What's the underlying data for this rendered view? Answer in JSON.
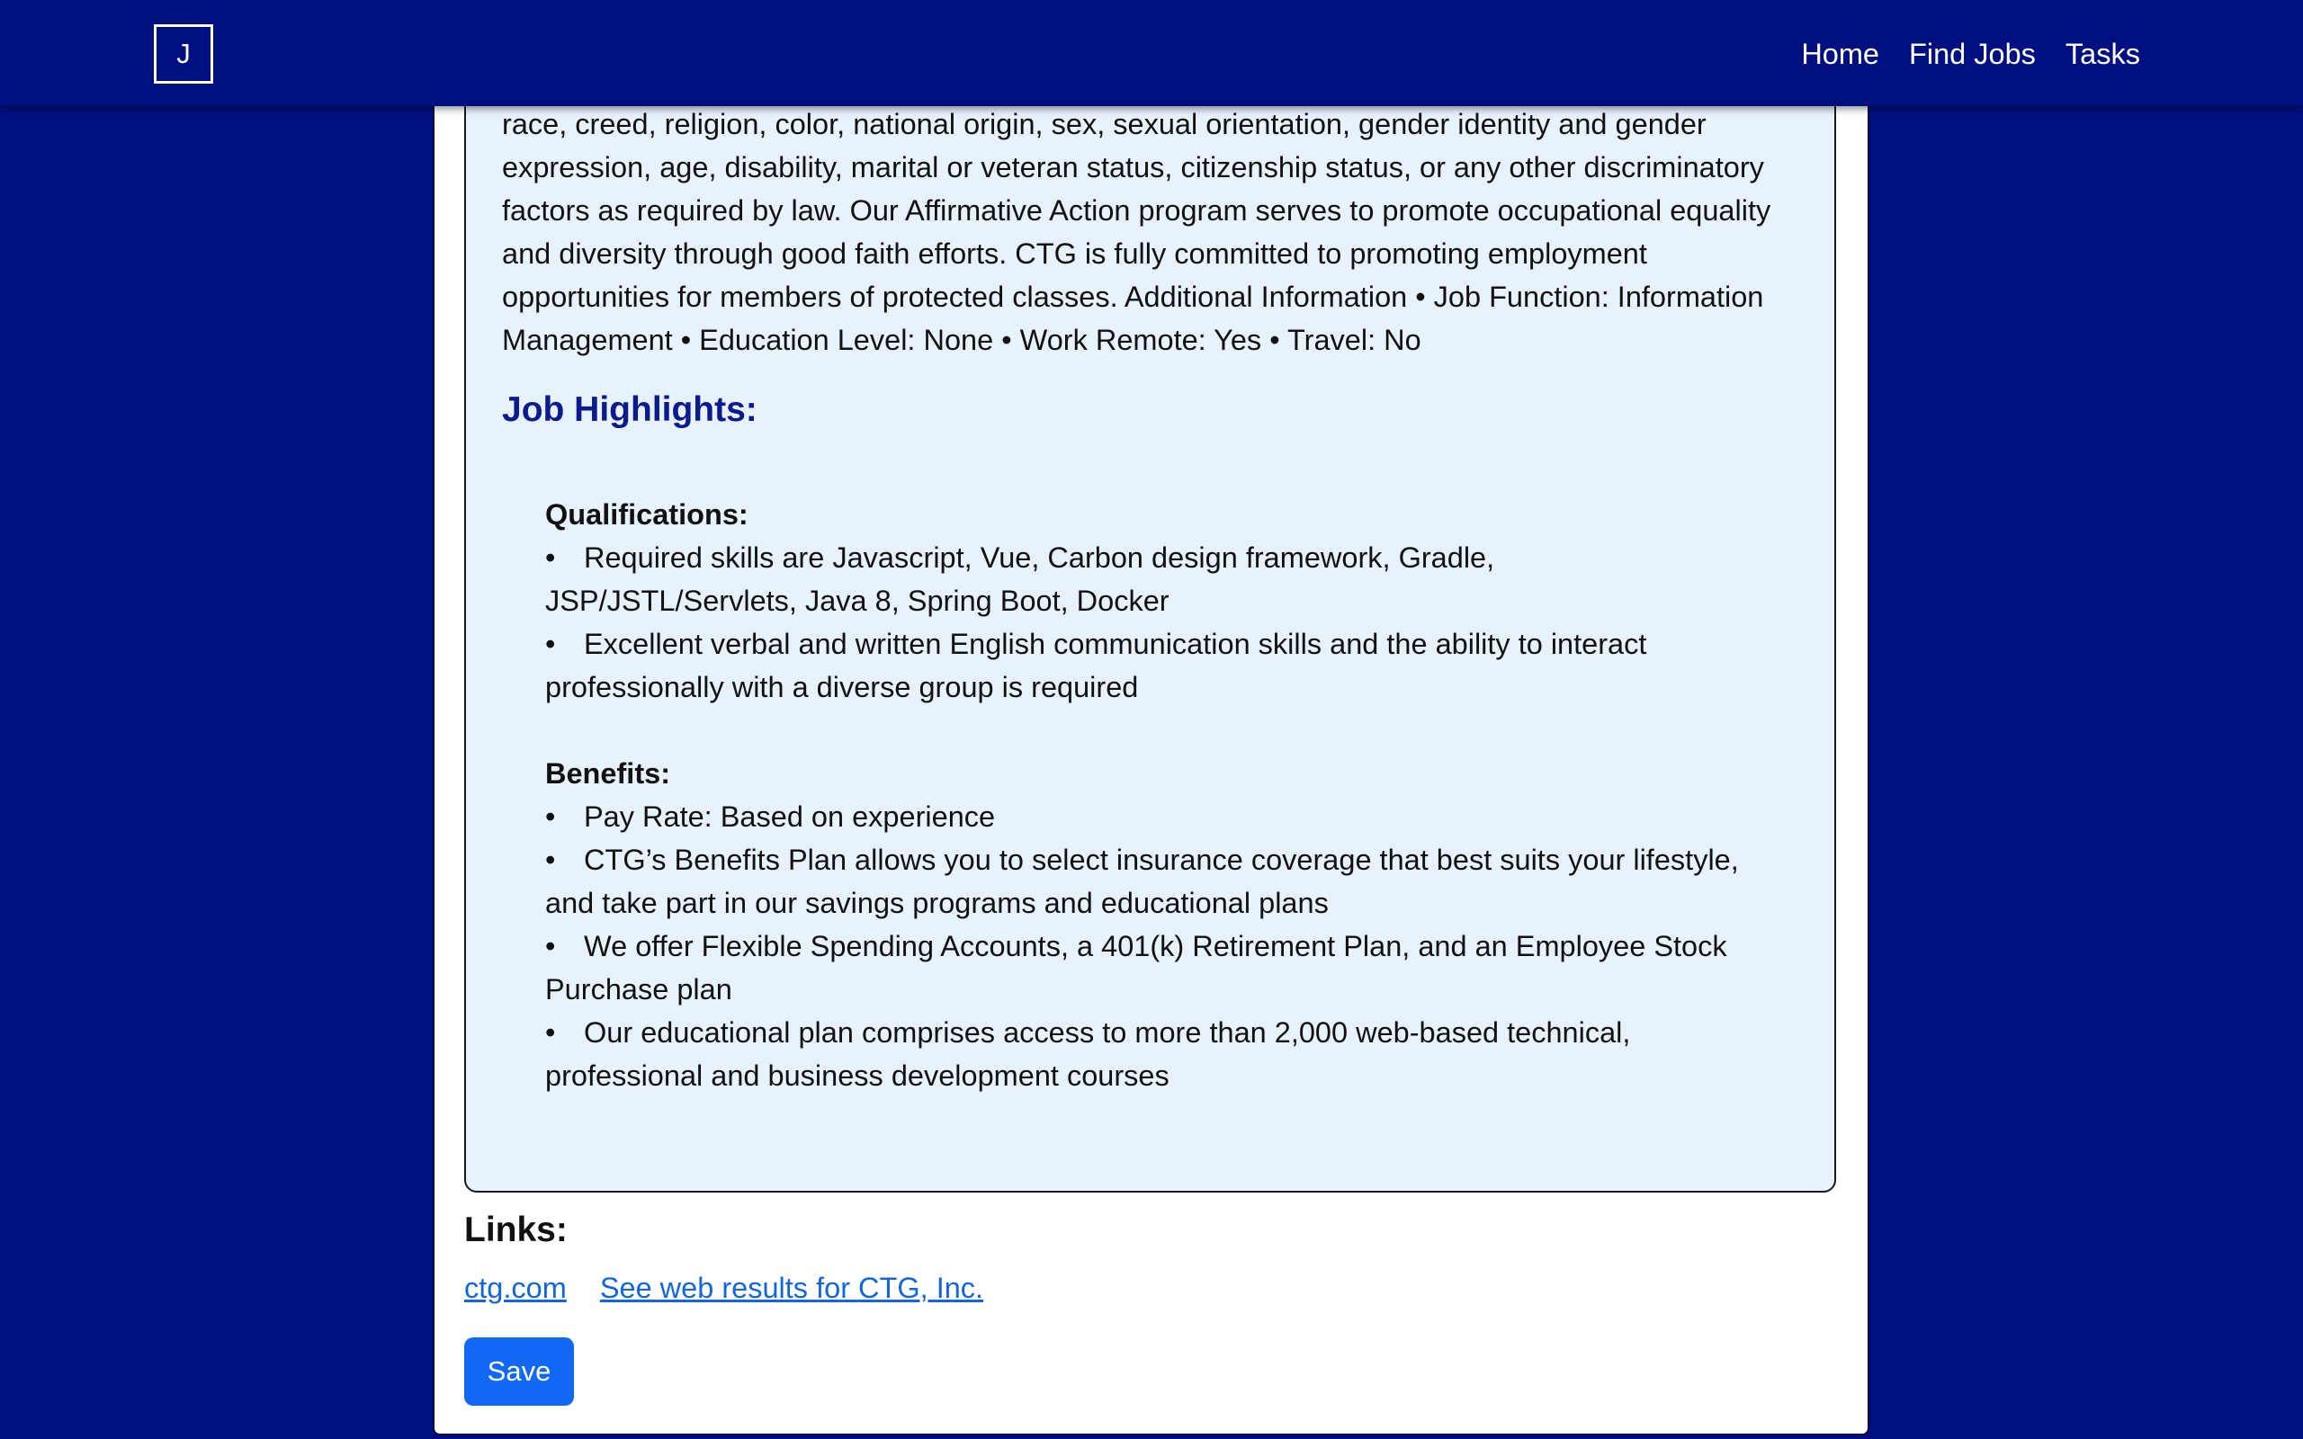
{
  "nav": {
    "logo_letter": "J",
    "links": [
      "Home",
      "Find Jobs",
      "Tasks"
    ]
  },
  "description": {
    "text": "training, benefits, compensation, promotion, transfer, and release of individuals without regard to race, creed, religion, color, national origin, sex, sexual orientation, gender identity and gender expression, age, disability, marital or veteran status, citizenship status, or any other discriminatory factors as required by law. Our Affirmative Action program serves to promote occupational equality and diversity through good faith efforts. CTG is fully committed to promoting employment opportunities for members of protected classes. Additional Information • Job Function: Information Management • Education Level: None • Work Remote: Yes • Travel: No"
  },
  "highlights": {
    "title": "Job Highlights:",
    "qualifications": {
      "title": "Qualifications:",
      "items": [
        "Required skills are Javascript, Vue, Carbon design framework, Gradle, JSP/JSTL/Servlets, Java 8, Spring Boot, Docker",
        "Excellent verbal and written English communication skills and the ability to interact professionally with a diverse group is required"
      ]
    },
    "benefits": {
      "title": "Benefits:",
      "items": [
        "Pay Rate: Based on experience",
        "CTG’s Benefits Plan allows you to select insurance coverage that best suits your lifestyle, and take part in our savings programs and educational plans",
        "We offer Flexible Spending Accounts, a 401(k) Retirement Plan, and an Employee Stock Purchase plan",
        "Our educational plan comprises access to more than 2,000 web-based technical, professional and business development courses"
      ]
    }
  },
  "links": {
    "title": "Links:",
    "items": [
      "ctg.com",
      "See web results for CTG, Inc."
    ]
  },
  "save_label": "Save",
  "colors": {
    "page_background": "#000f80",
    "highlight_title": "#0b1a8c",
    "description_box": "#e8f2fd",
    "link": "#1565e0",
    "save_button": "#1068f4"
  }
}
